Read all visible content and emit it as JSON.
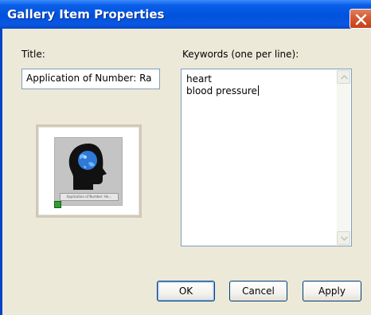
{
  "window": {
    "title": "Gallery Item Properties"
  },
  "form": {
    "title_label": "Title:",
    "title_value": "Application of Number: Ra",
    "keywords_label": "Keywords (one per line):",
    "keywords": [
      "heart",
      "blood pressure"
    ]
  },
  "preview": {
    "caption": "Application of Number: He..."
  },
  "buttons": {
    "ok": "OK",
    "cancel": "Cancel",
    "apply": "Apply"
  },
  "icons": {
    "close": "close-icon",
    "thumbnail": "head-globe-icon",
    "scroll_up": "arrow-up-icon",
    "scroll_down": "arrow-down-icon"
  },
  "colors": {
    "titlebar": "#0052dc",
    "close_button": "#d35a33",
    "dialog_background": "#ece9d8",
    "input_border": "#7f9db9",
    "button_border": "#003c74"
  }
}
